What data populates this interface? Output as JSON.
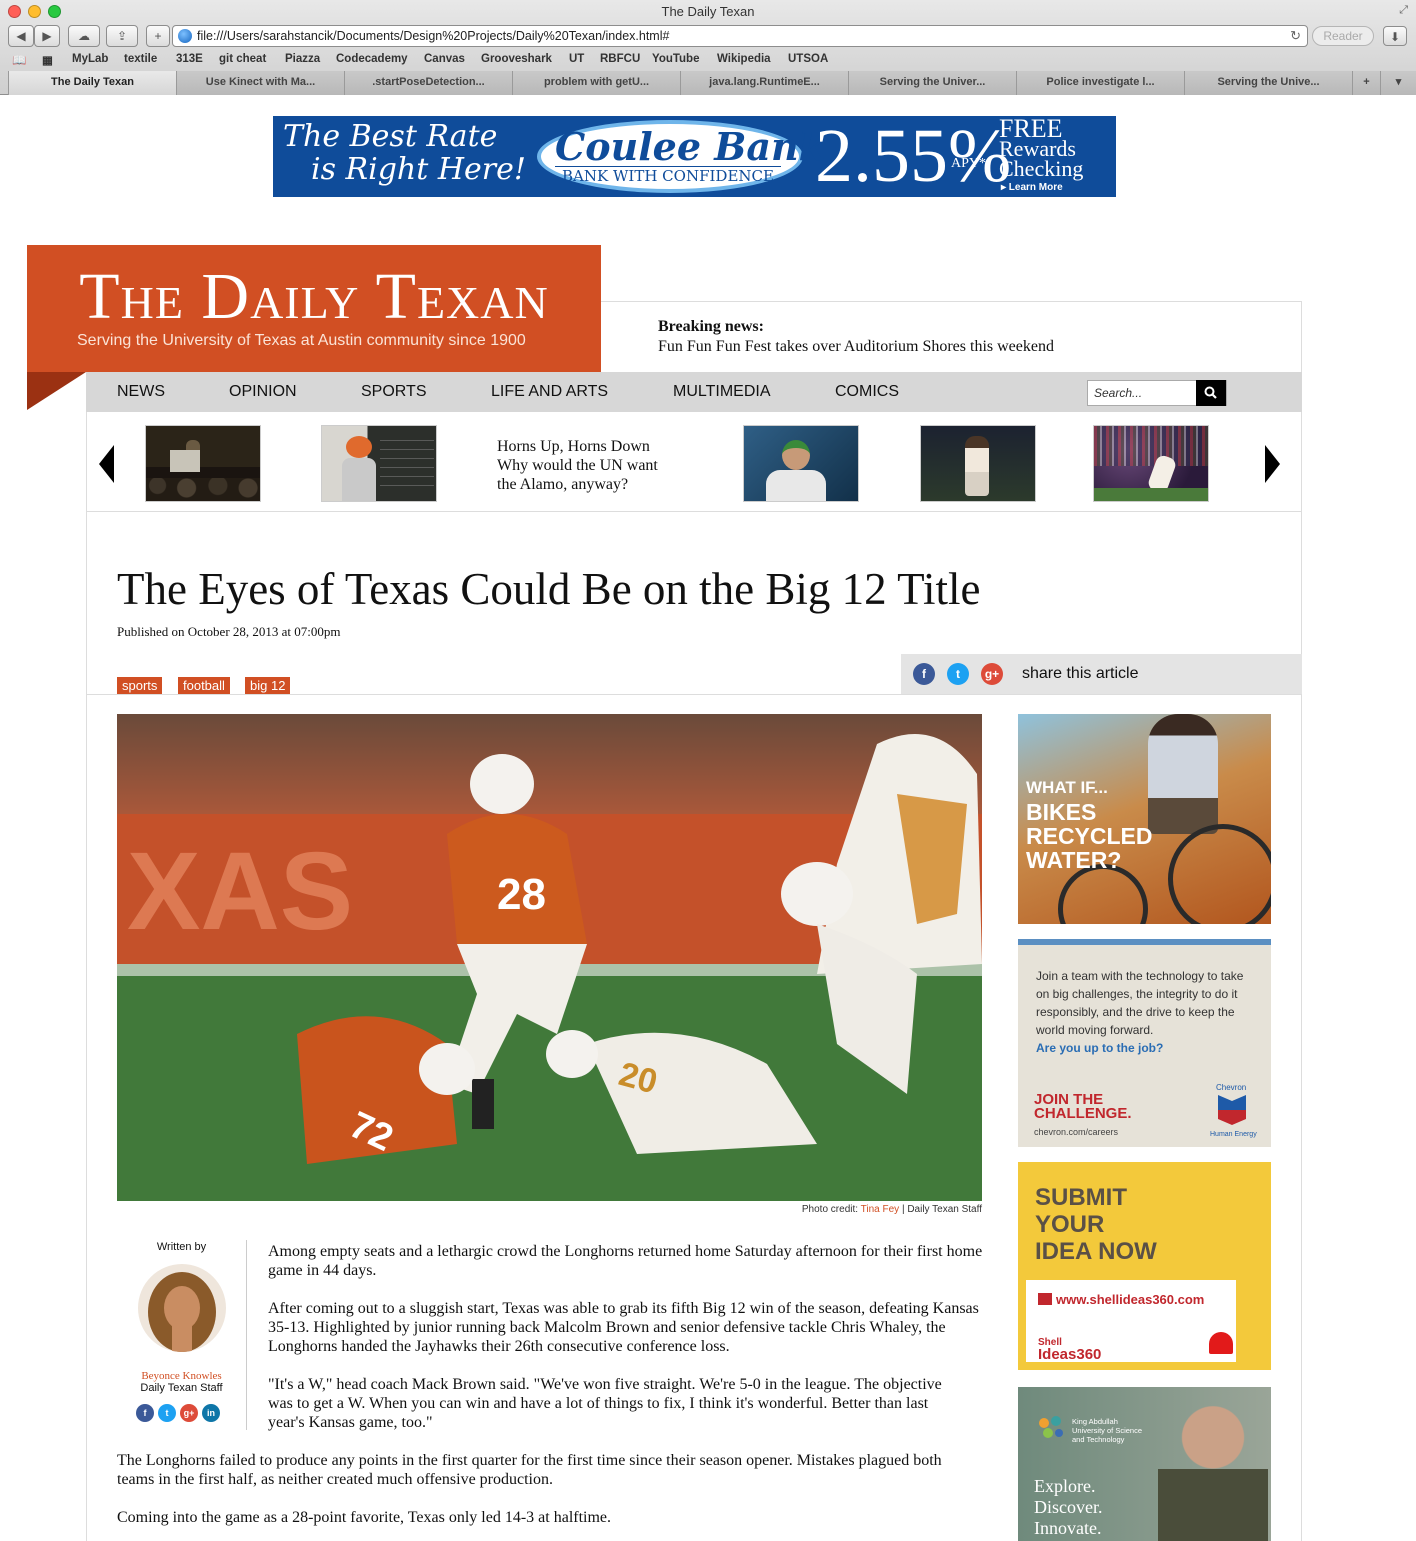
{
  "browser": {
    "window_title": "The Daily Texan",
    "url": "file:///Users/sarahstancik/Documents/Design%20Projects/Daily%20Texan/index.html#",
    "reader_label": "Reader",
    "bookmarks": [
      "MyLab",
      "textile",
      "313E",
      "git cheat",
      "Piazza",
      "Codecademy",
      "Canvas",
      "Grooveshark",
      "UT",
      "RBFCU",
      "YouTube",
      "Wikipedia",
      "UTSOA"
    ],
    "tabs": [
      "The Daily Texan",
      "Use Kinect with Ma...",
      ".startPoseDetection...",
      "problem with getU...",
      "java.lang.RuntimeE...",
      "Serving the Univer...",
      "Police investigate l...",
      "Serving the Unive..."
    ]
  },
  "top_ad": {
    "line1": "The Best Rate",
    "line2": "is Right Here!",
    "bank": "Coulee Bank",
    "slogan": "BANK WITH CONFIDENCE",
    "rate": "2.55%",
    "apy": "APY*",
    "free1": "FREE",
    "free2": "Rewards",
    "free3": "Checking",
    "learn": "▸ Learn More"
  },
  "masthead": {
    "title": "The Daily Texan",
    "tagline": "Serving the University of Texas at Austin community since 1900"
  },
  "breaking": {
    "label": "Breaking news:",
    "text": "Fun Fun Fun Fest takes over Auditorium Shores this weekend"
  },
  "nav": {
    "items": [
      "NEWS",
      "OPINION",
      "SPORTS",
      "LIFE AND ARTS",
      "MULTIMEDIA",
      "COMICS"
    ],
    "search_placeholder": "Search..."
  },
  "carousel": {
    "text_line1": "Horns Up, Horns Down",
    "text_line2": "Why would the UN want",
    "text_line3": "the Alamo, anyway?"
  },
  "article": {
    "headline": "The Eyes of Texas Could Be on the Big 12 Title",
    "published": "Published on October 28, 2013 at 07:00pm",
    "tags": [
      "sports",
      "football",
      "big 12"
    ],
    "share_label": "share this article",
    "photo_credit_prefix": "Photo credit: ",
    "photo_credit_name": "Tina Fey",
    "photo_credit_suffix": " | Daily Texan Staff",
    "author": {
      "written_by": "Written by",
      "name": "Beyonce Knowles",
      "staff": "Daily Texan Staff"
    },
    "paragraphs": [
      "Among empty seats and a lethargic crowd the Longhorns returned home Saturday afternoon for their first home game in 44 days.",
      "After coming out to a sluggish start, Texas was able to grab its fifth Big 12 win of the season, defeating Kansas 35-13. Highlighted by junior running back Malcolm Brown and senior defensive tackle Chris Whaley, the Longhorns handed the Jayhawks their 26th consecutive conference loss.",
      "\"It's a W,\" head coach Mack Brown said. \"We've won five straight. We're 5-0 in the league. The objective was to get a W. When you can win and have a lot of things to fix, I think it's wonderful. Better than last year's Kansas game, too.\"",
      "The Longhorns failed to produce any points in the first quarter for the first time since their season opener. Mistakes plagued both teams in the first half, as neither created much offensive production.",
      "Coming into the game as a 28-point favorite, Texas only led 14-3 at halftime."
    ]
  },
  "sidebar_ads": {
    "bikes": {
      "line1": "WHAT IF...",
      "line2": "BIKES",
      "line3": "RECYCLED",
      "line4": "WATER?"
    },
    "chevron": {
      "body": "Join a team with the technology to take on big challenges, the integrity to do it responsibly, and the drive to keep the world moving forward.",
      "question": "Are you up to the job?",
      "join1": "JOIN THE",
      "join2": "CHALLENGE.",
      "url": "chevron.com/careers",
      "brand": "Chevron",
      "tagline": "Human Energy"
    },
    "shell": {
      "line1": "SUBMIT",
      "line2": "YOUR",
      "line3": "IDEA NOW",
      "url": "www.shellideas360.com",
      "brand1": "Shell",
      "brand2": "Ideas360"
    },
    "kaust": {
      "org1": "King Abdullah",
      "org2": "University of Science",
      "org3": "and Technology",
      "tag1": "Explore.",
      "tag2": "Discover.",
      "tag3": "Innovate."
    }
  },
  "colors": {
    "brand_orange": "#d14f23",
    "nav_gray": "#d7d7d7",
    "ad_blue": "#0f4c9a",
    "facebook": "#3b5998",
    "twitter": "#1da1f2",
    "google_plus": "#dd4b39",
    "linkedin": "#0e76a8"
  }
}
